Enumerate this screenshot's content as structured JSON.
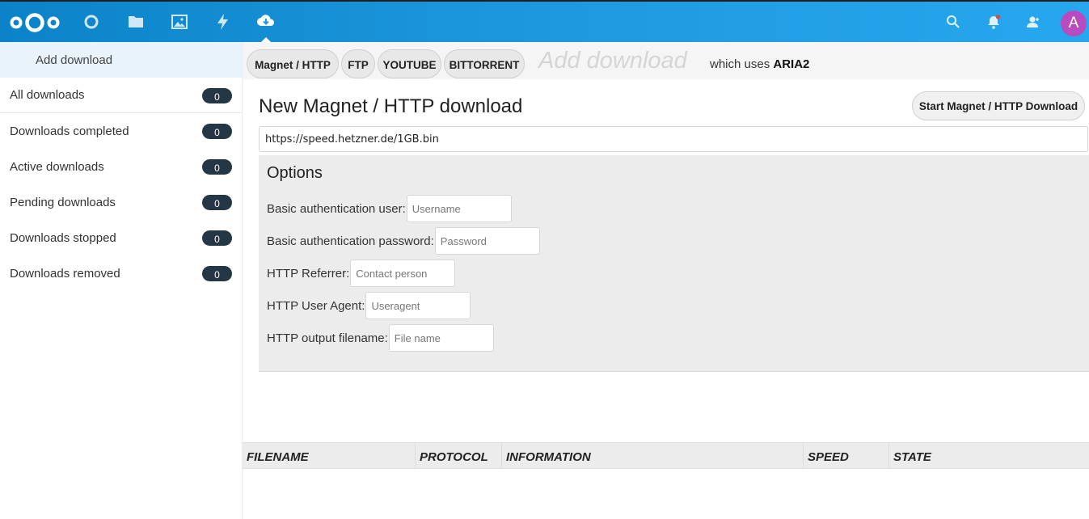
{
  "header": {
    "apps": [
      {
        "name": "dashboard-icon"
      },
      {
        "name": "files-icon"
      },
      {
        "name": "photos-icon"
      },
      {
        "name": "activity-icon"
      },
      {
        "name": "ncdownloader-icon"
      }
    ],
    "right_icons": [
      "search-icon",
      "notifications-icon",
      "contacts-icon"
    ],
    "avatar_letter": "A",
    "colors": {
      "bar": "#1f9ae0",
      "avatar": "#b84bbf"
    }
  },
  "sidebar": {
    "add_download": "Add download",
    "items": [
      {
        "label": "All downloads",
        "count": "0"
      },
      {
        "label": "Downloads completed",
        "count": "0"
      },
      {
        "label": "Active downloads",
        "count": "0"
      },
      {
        "label": "Pending downloads",
        "count": "0"
      },
      {
        "label": "Downloads stopped",
        "count": "0"
      },
      {
        "label": "Downloads removed",
        "count": "0"
      }
    ]
  },
  "tabs": {
    "items": [
      "Magnet / HTTP",
      "FTP",
      "YOUTUBE",
      "BITTORRENT"
    ],
    "ghost_title": "Add download",
    "uses_prefix": "which uses",
    "uses_engine": "ARIA2"
  },
  "main": {
    "title": "New Magnet / HTTP download",
    "start_button": "Start Magnet / HTTP Download",
    "url_value": "https://speed.hetzner.de/1GB.bin"
  },
  "options": {
    "title": "Options",
    "fields": [
      {
        "label": "Basic authentication user:",
        "placeholder": "Username"
      },
      {
        "label": "Basic authentication password:",
        "placeholder": "Password"
      },
      {
        "label": "HTTP Referrer:",
        "placeholder": "Contact person"
      },
      {
        "label": "HTTP User Agent:",
        "placeholder": "Useragent"
      },
      {
        "label": "HTTP output filename:",
        "placeholder": "File name"
      }
    ]
  },
  "table": {
    "columns": [
      "FILENAME",
      "PROTOCOL",
      "INFORMATION",
      "SPEED",
      "STATE"
    ]
  }
}
